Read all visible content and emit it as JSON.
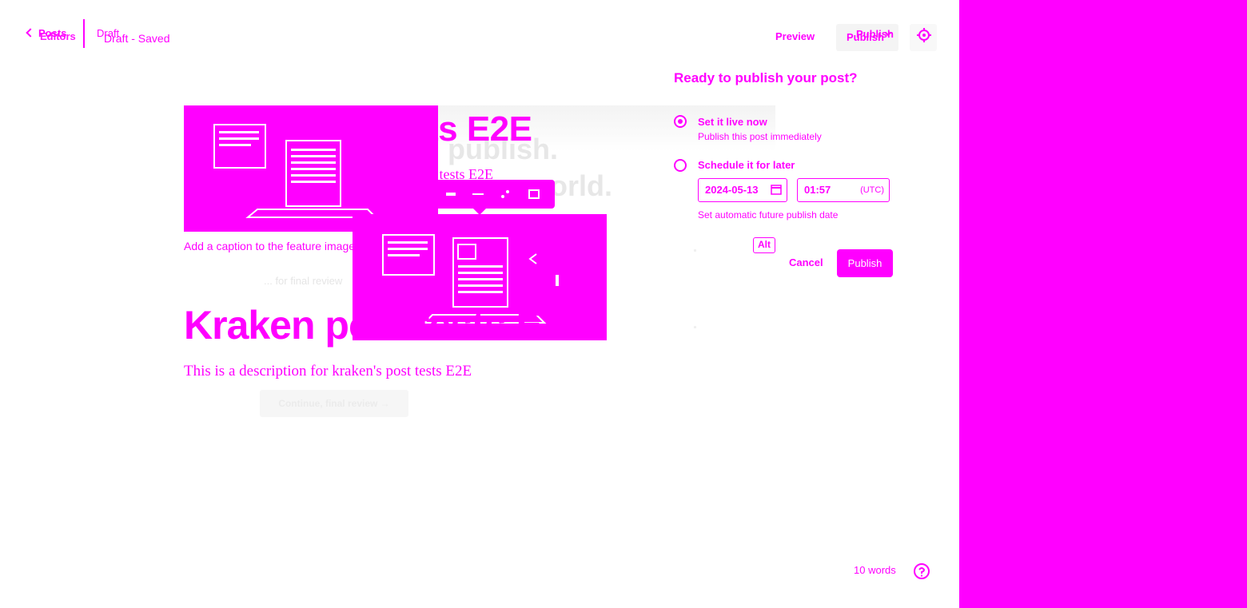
{
  "colors": {
    "accent": "#ff00ff",
    "background": "#ffffff"
  },
  "topbar": {
    "back_label": "Posts",
    "back_label_overlay": "Editors",
    "status_label": "Draft",
    "saved_label": "Draft - Saved",
    "preview_label": "Preview",
    "publish_label": "Publish",
    "publish_label_overlay": "Publish",
    "settings_icon": "gear-icon"
  },
  "editor": {
    "ghost_title": "sts E2E",
    "ghost_subtitle_1": "publish.",
    "ghost_subtitle_2": "world.",
    "ghost_description": "post tests E2E",
    "caption_placeholder": "Add a caption to the feature image",
    "post_title": "Kraken post tests E2E",
    "post_description": "This is a description for kraken's post tests E2E",
    "continue_label": "Continue, final review →",
    "faint_line": "... for final review",
    "word_count": "10 words",
    "word_count_overlay": "10 words"
  },
  "publish_popover": {
    "title": "Ready to publish your post?",
    "option_now_label": "Set it live now",
    "option_now_help": "Publish this post immediately",
    "option_schedule_label": "Schedule it for later",
    "date_value": "2024-05-13",
    "time_value": "01:57",
    "timezone": "(UTC)",
    "schedule_help": "Set automatic future publish date",
    "alt_chip": "Alt",
    "cancel_label": "Cancel",
    "publish_label": "Publish"
  }
}
